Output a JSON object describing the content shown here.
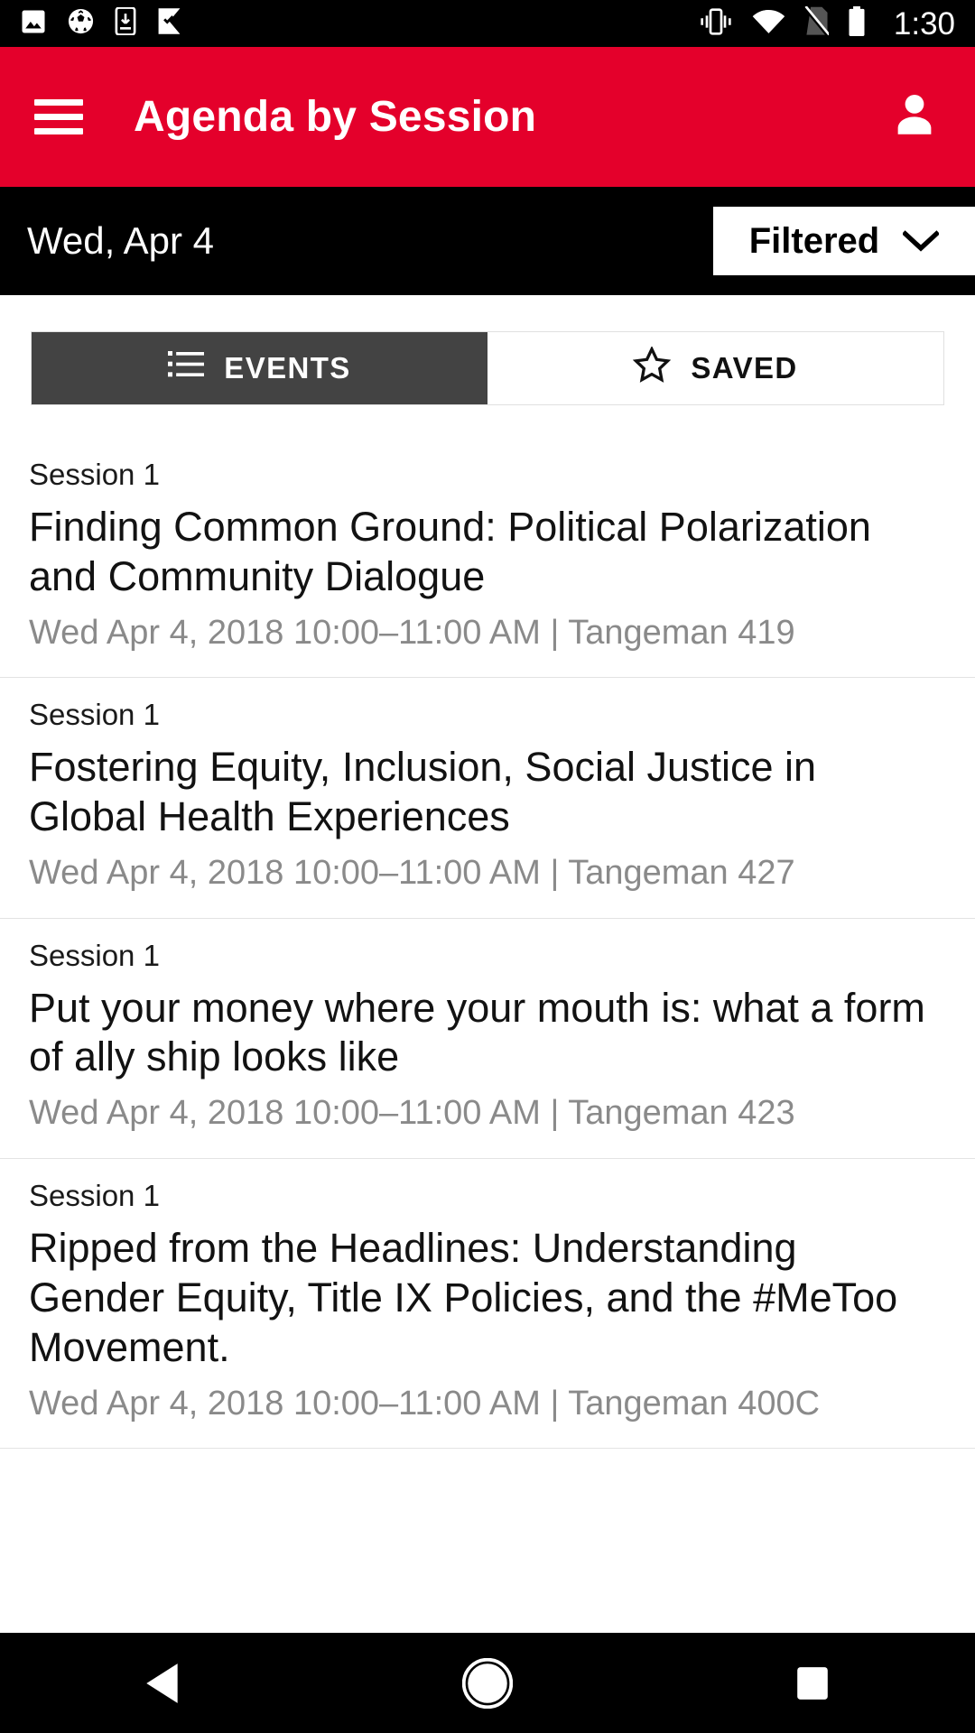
{
  "status_bar": {
    "icons_left": [
      "image-icon",
      "soccer-ball-icon",
      "download-to-phone-icon",
      "check-flag-icon"
    ],
    "icons_right": [
      "vibrate-icon",
      "wifi-icon",
      "no-sim-icon",
      "battery-icon"
    ],
    "time": "1:30"
  },
  "app_bar": {
    "menu_icon": "hamburger-menu-icon",
    "title": "Agenda by Session",
    "account_icon": "person-account-icon"
  },
  "date_bar": {
    "date_label": "Wed, Apr 4",
    "filter": {
      "label": "Filtered",
      "chevron_icon": "chevron-down-icon"
    }
  },
  "tabs": [
    {
      "label": "EVENTS",
      "icon": "list-icon",
      "active": true
    },
    {
      "label": "SAVED",
      "icon": "star-outline-icon",
      "active": false
    }
  ],
  "sessions": [
    {
      "session_label": "Session 1",
      "title": "Finding Common Ground: Political Polarization and Community Dialogue",
      "meta": "Wed Apr 4, 2018 10:00–11:00 AM | Tangeman 419"
    },
    {
      "session_label": "Session 1",
      "title": "Fostering Equity, Inclusion, Social Justice in Global Health Experiences",
      "meta": "Wed Apr 4, 2018 10:00–11:00 AM | Tangeman 427"
    },
    {
      "session_label": "Session 1",
      "title": "Put your money where your mouth is: what a form of ally ship looks like",
      "meta": "Wed Apr 4, 2018 10:00–11:00 AM | Tangeman 423"
    },
    {
      "session_label": "Session 1",
      "title": "Ripped from the Headlines: Understanding Gender Equity, Title IX Policies, and the #MeToo Movement.",
      "meta": "Wed Apr 4, 2018 10:00–11:00 AM | Tangeman 400C"
    }
  ],
  "nav_bar": {
    "back_icon": "back-triangle-icon",
    "home_icon": "home-circle-icon",
    "recents_icon": "recents-square-icon"
  },
  "colors": {
    "brand_red": "#e4002b",
    "active_tab": "#434343",
    "meta_gray": "#8a8a8a",
    "bar_black": "#000000"
  }
}
